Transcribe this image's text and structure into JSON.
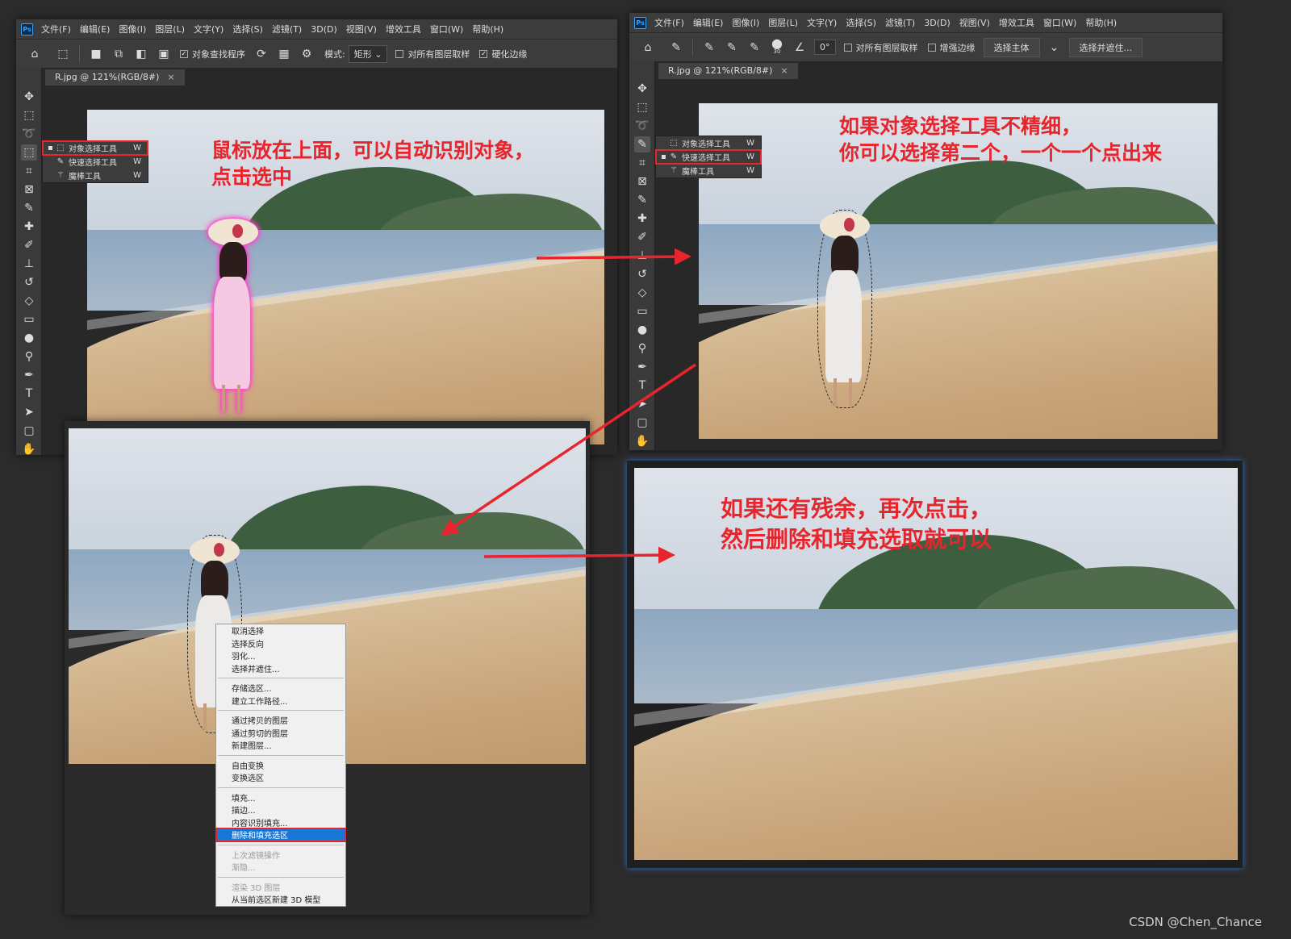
{
  "window1": {
    "menu": [
      "文件(F)",
      "编辑(E)",
      "图像(I)",
      "图层(L)",
      "文字(Y)",
      "选择(S)",
      "滤镜(T)",
      "3D(D)",
      "视图(V)",
      "增效工具",
      "窗口(W)",
      "帮助(H)"
    ],
    "options": {
      "object_finder_label": "对象查找程序",
      "mode_label": "模式:",
      "mode_value": "矩形",
      "sample_all_layers": "对所有图层取样",
      "hard_edge": "硬化边缘"
    },
    "doc_tab": "R.jpg @ 121%(RGB/8#)",
    "flyout": [
      {
        "label": "对象选择工具",
        "key": "W",
        "icon": "object-select-icon"
      },
      {
        "label": "快速选择工具",
        "key": "W",
        "icon": "quick-select-icon"
      },
      {
        "label": "魔棒工具",
        "key": "W",
        "icon": "magic-wand-icon"
      }
    ],
    "annotation": "鼠标放在上面，可以自动识别对象，\n点击选中"
  },
  "window2": {
    "menu": [
      "文件(F)",
      "编辑(E)",
      "图像(I)",
      "图层(L)",
      "文字(Y)",
      "选择(S)",
      "滤镜(T)",
      "3D(D)",
      "视图(V)",
      "增效工具",
      "窗口(W)",
      "帮助(H)"
    ],
    "options": {
      "brush_size": "30",
      "angle": "0°",
      "sample_all_layers": "对所有图层取样",
      "enhance_edge": "增强边缘",
      "select_subject": "选择主体",
      "select_and_mask": "选择并遮住..."
    },
    "doc_tab": "R.jpg @ 121%(RGB/8#)",
    "flyout": [
      {
        "label": "对象选择工具",
        "key": "W",
        "icon": "object-select-icon"
      },
      {
        "label": "快速选择工具",
        "key": "W",
        "icon": "quick-select-icon"
      },
      {
        "label": "魔棒工具",
        "key": "W",
        "icon": "magic-wand-icon"
      }
    ],
    "annotation": "如果对象选择工具不精细，\n你可以选择第二个，一个一个点出来"
  },
  "context_menu": {
    "groups": [
      [
        "取消选择",
        "选择反向",
        "羽化...",
        "选择并遮住..."
      ],
      [
        "存储选区...",
        "建立工作路径..."
      ],
      [
        "通过拷贝的图层",
        "通过剪切的图层",
        "新建图层..."
      ],
      [
        "自由变换",
        "变换选区"
      ],
      [
        "填充...",
        "描边...",
        "内容识别填充...",
        "删除和填充选区"
      ],
      [
        "上次滤镜操作",
        "渐隐..."
      ],
      [
        "渲染 3D 图层",
        "从当前选区新建 3D 模型"
      ]
    ],
    "selected": "删除和填充选区",
    "disabled": [
      "上次滤镜操作",
      "渐隐...",
      "渲染 3D 图层"
    ]
  },
  "result_annotation": "如果还有残余，再次点击，\n然后删除和填充选取就可以",
  "watermark": "CSDN @Chen_Chance",
  "colors": {
    "annotation_red": "#e8242c",
    "selection_glow": "#ff3fc8",
    "menu_highlight": "#1977d6"
  }
}
